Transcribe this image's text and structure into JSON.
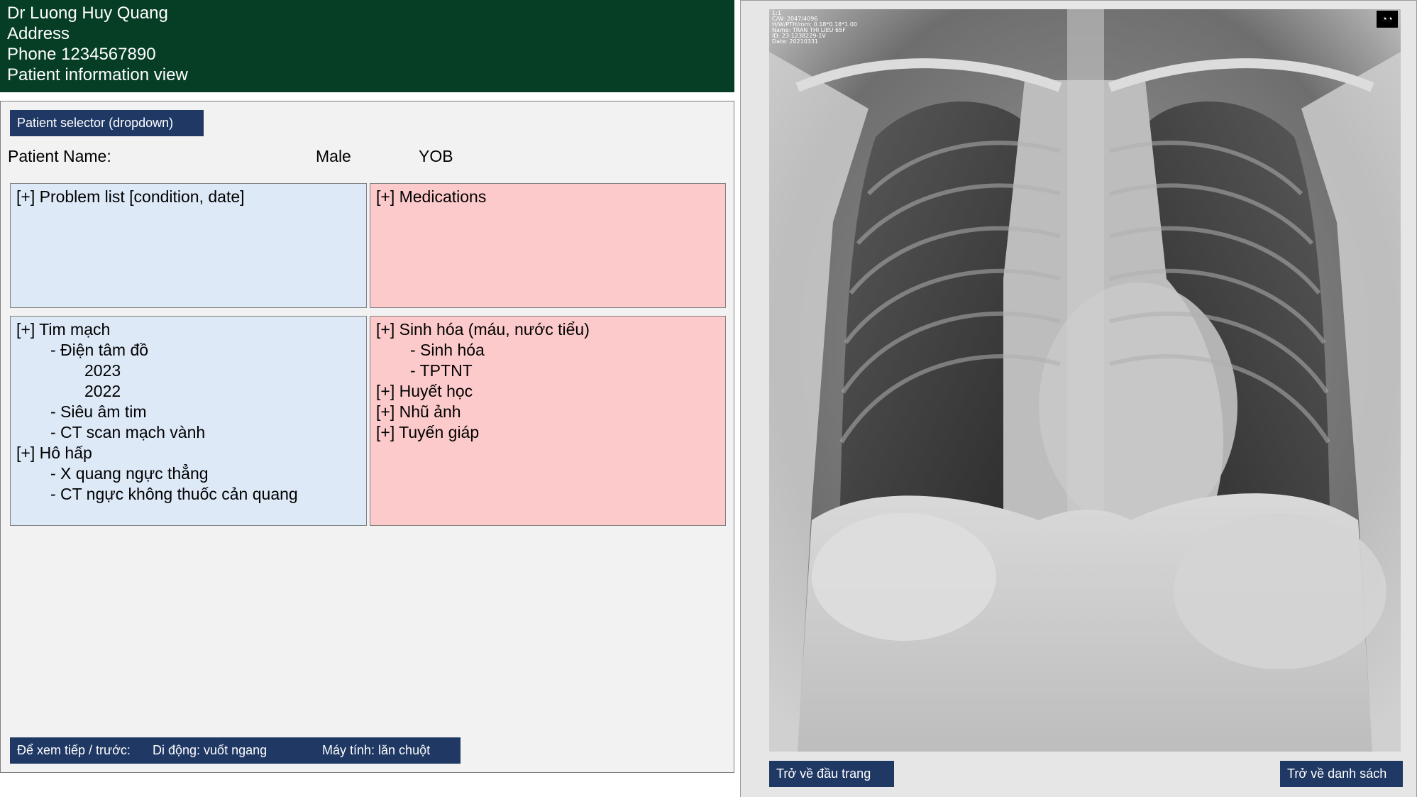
{
  "header": {
    "doctor_name": "Dr Luong Huy Quang",
    "address": "Address",
    "phone": "Phone 1234567890",
    "view_title": "Patient information view"
  },
  "patient": {
    "selector_label": "Patient selector (dropdown)",
    "name_label": "Patient Name:",
    "gender": "Male",
    "yob_label": "YOB"
  },
  "panels": {
    "problem_list": {
      "title": "[+] Problem list [condition, date]"
    },
    "medications": {
      "title": "[+] Medications"
    },
    "cardio_resp": {
      "lines": [
        "[+] Tim mạch",
        "- Điện tâm đồ",
        "2023",
        "2022",
        "- Siêu âm tim",
        "- CT scan mạch vành",
        "[+] Hô hấp",
        "- X quang ngực thẳng",
        "- CT ngực không thuốc cản quang"
      ]
    },
    "labs": {
      "lines": [
        "[+] Sinh hóa (máu, nước tiểu)",
        "- Sinh hóa",
        "- TPTNT",
        "[+] Huyết học",
        "[+] Nhũ ảnh",
        "[+] Tuyến giáp"
      ]
    }
  },
  "nav_hint": {
    "label": "Để xem tiếp / trước:",
    "mobile": "Di động: vuốt ngang",
    "desktop": "Máy tính: lăn chuột"
  },
  "viewer": {
    "overlay_lines": [
      "1:1",
      "C/W: 2047/4096",
      "H/W/PTH/mm: 0.18*0.18*1.00",
      "Name: TRAN THI LIEU 65F",
      "ID: 23-1238229-1V",
      "Date: 20210331"
    ],
    "glasses_icon_glyph": "◔◔",
    "back_to_top": "Trở về đầu trang",
    "back_to_list": "Trở về danh sách"
  }
}
